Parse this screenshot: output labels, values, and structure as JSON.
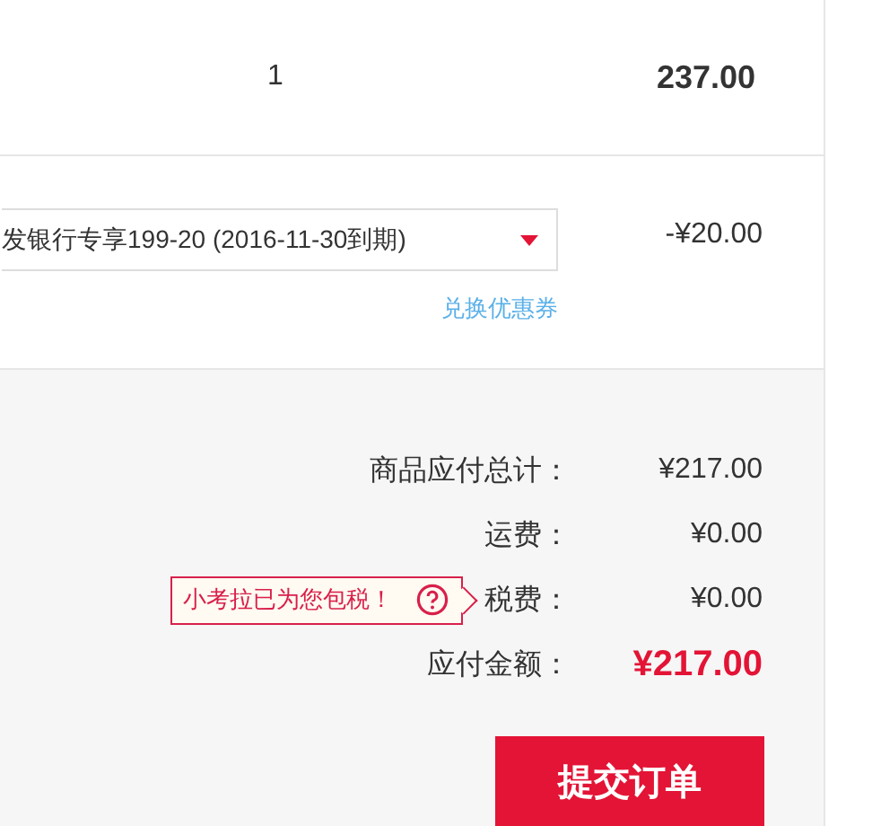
{
  "item_row": {
    "quantity": "1",
    "price": "237.00"
  },
  "coupon": {
    "value": "发银行专享199-20  (2016-11-30到期)",
    "discount": "-¥20.00",
    "redeem_link": "兑换优惠券"
  },
  "summary": [
    {
      "kind": "plain",
      "label": "商品应付总计：",
      "value": "¥217.00"
    },
    {
      "kind": "plain",
      "label": "运费：",
      "value": "¥0.00"
    },
    {
      "kind": "tax",
      "label": "税费：",
      "value": "¥0.00",
      "note": "小考拉已为您包税！"
    },
    {
      "kind": "total",
      "label": "应付金额：",
      "value": "¥217.00"
    }
  ],
  "submit_button": "提交订单"
}
